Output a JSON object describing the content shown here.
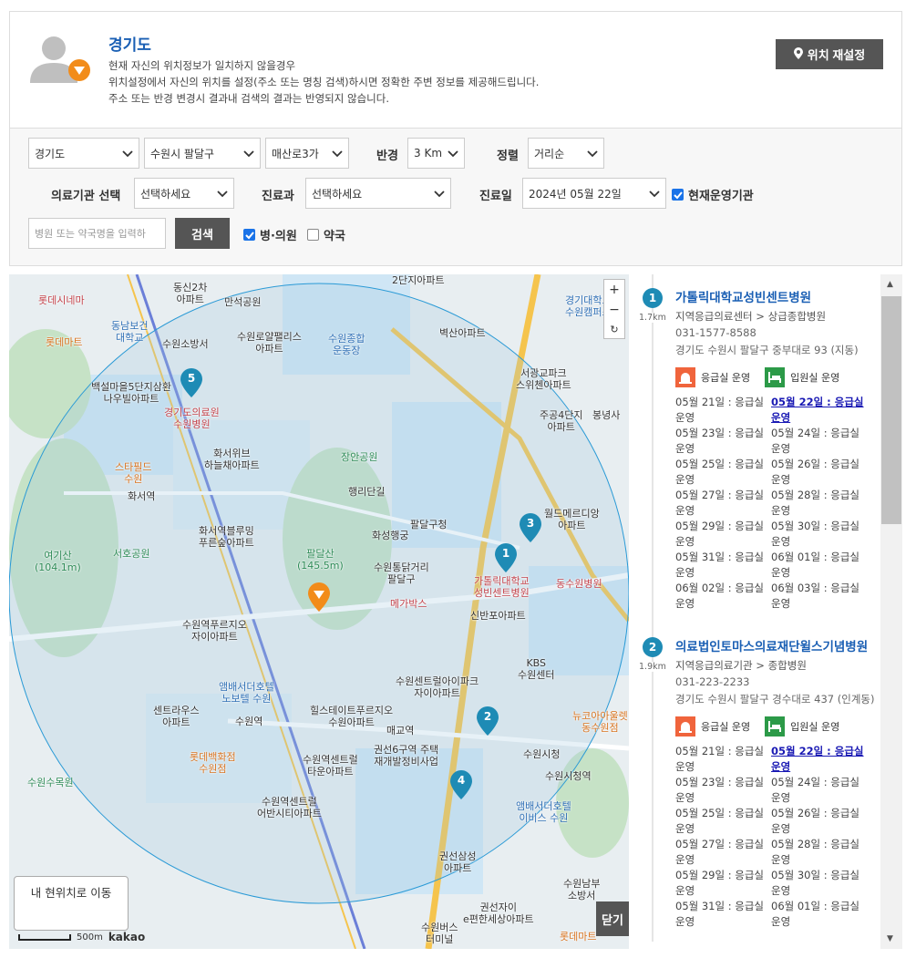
{
  "location": {
    "region": "경기도",
    "desc_lines": [
      "현재 자신의 위치정보가 일치하지 않을경우",
      "위치설정에서 자신의 위치를 설정(주소 또는 명칭 검색)하시면 정확한 주변 정보를 제공해드립니다.",
      "주소 또는 반경 변경시 결과내 검색의 결과는 반영되지 않습니다."
    ],
    "reset_label": "위치 재설정"
  },
  "filters": {
    "province": "경기도",
    "city": "수원시 팔달구",
    "dong": "매산로3가",
    "radius_label": "반경",
    "radius": "3 Km",
    "sort_label": "정렬",
    "sort": "거리순",
    "institution_label": "의료기관 선택",
    "institution": "선택하세요",
    "dept_label": "진료과",
    "dept": "선택하세요",
    "date_label": "진료일",
    "date": "2024년 05월 22일",
    "operating_label": "현재운영기관",
    "search_placeholder": "병원 또는 약국명을 입력하",
    "search_label": "검색",
    "hospital_label": "병·의원",
    "pharmacy_label": "약국"
  },
  "map": {
    "zoom_in": "+",
    "zoom_out": "−",
    "refresh": "↻",
    "my_location": "내 현위치로 이동",
    "close": "닫기",
    "scale": "500m",
    "provider": "kakao",
    "labels": [
      {
        "t": "롯데시네마",
        "c": "red"
      },
      {
        "t": "동신2차\n아파트"
      },
      {
        "t": "2단지아파트"
      },
      {
        "t": "경기대학교\n수원캠퍼스",
        "c": "blu"
      },
      {
        "t": "동남보건\n대학교",
        "c": "blu"
      },
      {
        "t": "만석공원"
      },
      {
        "t": "롯데마트",
        "c": "org"
      },
      {
        "t": "수원로얄팰리스\n아파트"
      },
      {
        "t": "수원종합\n운동장",
        "c": "blu"
      },
      {
        "t": "벽산아파트"
      },
      {
        "t": "수원소방서"
      },
      {
        "t": "서광교파크\n스위첸아파트"
      },
      {
        "t": "백설마을5단지삼환\n나우빌아파트"
      },
      {
        "t": "주공4단지\n아파트"
      },
      {
        "t": "봉녕사"
      },
      {
        "t": "경기도의료원\n수원병원",
        "c": "red"
      },
      {
        "t": "장안공원",
        "c": "grn"
      },
      {
        "t": "화서위브\n하늘채아파트"
      },
      {
        "t": "스타필드\n수원",
        "c": "org"
      },
      {
        "t": "행리단길"
      },
      {
        "t": "화서역"
      },
      {
        "t": "팔달구청"
      },
      {
        "t": "월드메르디앙\n아파트"
      },
      {
        "t": "화성행궁"
      },
      {
        "t": "화서역블루밍\n푸른숲아파트"
      },
      {
        "t": "팔달산\n(145.5m)",
        "c": "grn"
      },
      {
        "t": "여기산\n(104.1m)",
        "c": "grn"
      },
      {
        "t": "서호공원",
        "c": "grn"
      },
      {
        "t": "수원통닭거리\n팔달구"
      },
      {
        "t": "가톨릭대학교\n성빈센트병원",
        "c": "red"
      },
      {
        "t": "동수원병원",
        "c": "red"
      },
      {
        "t": "메가박스",
        "c": "red"
      },
      {
        "t": "신반포아파트"
      },
      {
        "t": "수원역푸르지오\n자이아파트"
      },
      {
        "t": "KBS\n수원센터"
      },
      {
        "t": "앰배서더호텔\n노보텔 수원",
        "c": "blu"
      },
      {
        "t": "수원센트럴아이파크\n자이아파트"
      },
      {
        "t": "센트라우스\n아파트"
      },
      {
        "t": "힐스테이트푸르지오\n수원아파트"
      },
      {
        "t": "뉴코아아울렛\n동수원점",
        "c": "org"
      },
      {
        "t": "수원역"
      },
      {
        "t": "매교역"
      },
      {
        "t": "롯데백화점\n수원점",
        "c": "org"
      },
      {
        "t": "권선6구역 주택\n재개발정비사업"
      },
      {
        "t": "수원시청"
      },
      {
        "t": "수원역센트럴\n타운아파트"
      },
      {
        "t": "수원시청역"
      },
      {
        "t": "수원수목원",
        "c": "grn"
      },
      {
        "t": "수원역센트럴\n어반시티아파트"
      },
      {
        "t": "앰배서더호텔\n이비스 수원",
        "c": "blu"
      },
      {
        "t": "권선삼성\n아파트"
      },
      {
        "t": "수원남부\n소방서"
      },
      {
        "t": "권선자이\ne편한세상아파트"
      },
      {
        "t": "수원버스\n터미널"
      },
      {
        "t": "롯데마트",
        "c": "org"
      }
    ],
    "pins": [
      "1",
      "2",
      "3",
      "4",
      "5"
    ]
  },
  "results": [
    {
      "num": "1",
      "dist": "1.7km",
      "name": "가톨릭대학교성빈센트병원",
      "category": "지역응급의료센터 > 상급종합병원",
      "phone": "031-1577-8588",
      "address": "경기도 수원시 팔달구 중부대로 93 (지동)",
      "er": "응급실 운영",
      "ward": "입원실 운영",
      "days": [
        "05월 21일 : 응급실운영",
        "05월 22일 : 응급실운영",
        "05월 23일 : 응급실운영",
        "05월 24일 : 응급실운영",
        "05월 25일 : 응급실운영",
        "05월 26일 : 응급실운영",
        "05월 27일 : 응급실운영",
        "05월 28일 : 응급실운영",
        "05월 29일 : 응급실운영",
        "05월 30일 : 응급실운영",
        "05월 31일 : 응급실운영",
        "06월 01일 : 응급실운영",
        "06월 02일 : 응급실운영",
        "06월 03일 : 응급실운영"
      ]
    },
    {
      "num": "2",
      "dist": "1.9km",
      "name": "의료법인토마스의료재단윌스기념병원",
      "category": "지역응급의료기관 > 종합병원",
      "phone": "031-223-2233",
      "address": "경기도 수원시 팔달구 경수대로 437 (인계동)",
      "er": "응급실 운영",
      "ward": "입원실 운영",
      "days": [
        "05월 21일 : 응급실운영",
        "05월 22일 : 응급실운영",
        "05월 23일 : 응급실운영",
        "05월 24일 : 응급실운영",
        "05월 25일 : 응급실운영",
        "05월 26일 : 응급실운영",
        "05월 27일 : 응급실운영",
        "05월 28일 : 응급실운영",
        "05월 29일 : 응급실운영",
        "05월 30일 : 응급실운영",
        "05월 31일 : 응급실운영",
        "06월 01일 : 응급실운영"
      ]
    }
  ],
  "colors": {
    "accent": "#1a5fb4",
    "pin": "#1e8bb5",
    "marker": "#f28c1a",
    "button": "#555555"
  }
}
